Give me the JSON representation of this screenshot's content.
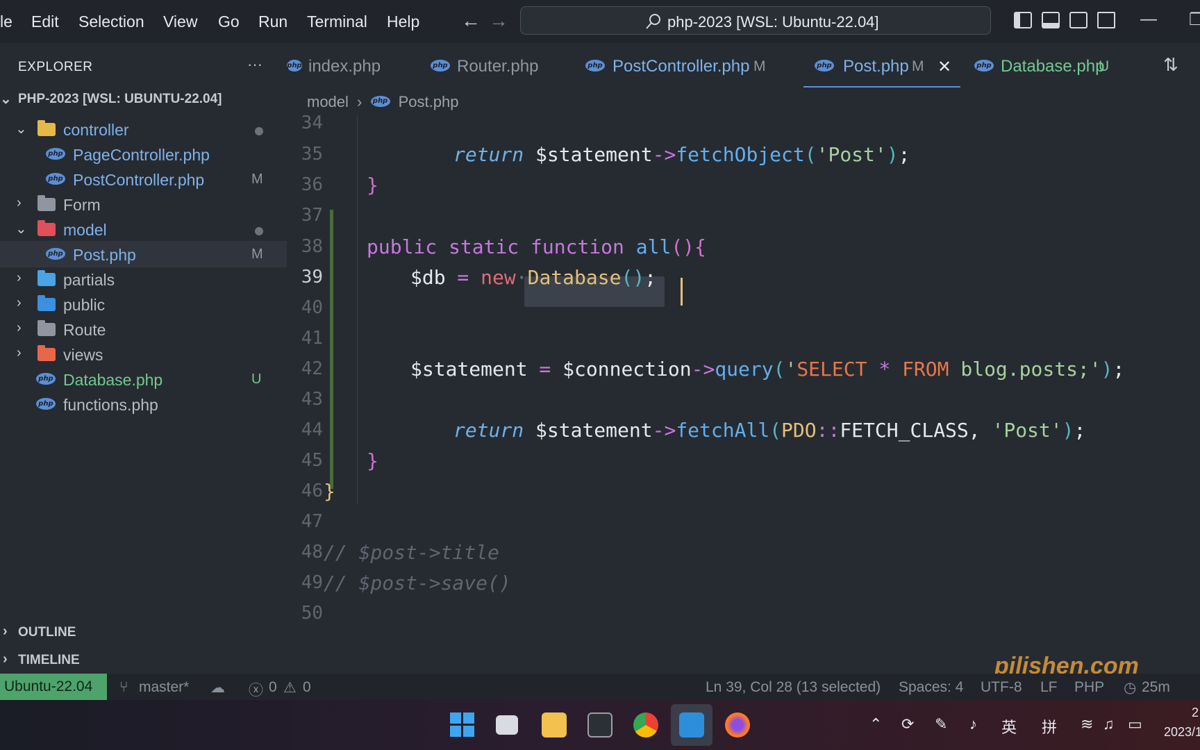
{
  "menu": [
    "le",
    "Edit",
    "Selection",
    "View",
    "Go",
    "Run",
    "Terminal",
    "Help"
  ],
  "command_center": "php-2023 [WSL: Ubuntu-22.04]",
  "explorer": {
    "title": "EXPLORER",
    "more": "···",
    "root": "PHP-2023 [WSL: UBUNTU-22.04]",
    "items": [
      {
        "label": "controller",
        "badge": ""
      },
      {
        "label": "PageController.php",
        "badge": ""
      },
      {
        "label": "PostController.php",
        "badge": "M"
      },
      {
        "label": "Form",
        "badge": ""
      },
      {
        "label": "model",
        "badge": ""
      },
      {
        "label": "Post.php",
        "badge": "M"
      },
      {
        "label": "partials",
        "badge": ""
      },
      {
        "label": "public",
        "badge": ""
      },
      {
        "label": "Route",
        "badge": ""
      },
      {
        "label": "views",
        "badge": ""
      },
      {
        "label": "Database.php",
        "badge": "U"
      },
      {
        "label": "functions.php",
        "badge": ""
      }
    ],
    "outline": "OUTLINE",
    "timeline": "TIMELINE"
  },
  "tabs": [
    {
      "label": "index.php",
      "badge": ""
    },
    {
      "label": "Router.php",
      "badge": ""
    },
    {
      "label": "PostController.php",
      "badge": "M"
    },
    {
      "label": "Post.php",
      "badge": "M",
      "close": "✕"
    },
    {
      "label": "Database.php",
      "badge": "U"
    }
  ],
  "breadcrumb": {
    "folder": "model",
    "sep": "›",
    "file": "Post.php"
  },
  "php_icon_text": "php",
  "line_numbers": [
    "34",
    "35",
    "36",
    "37",
    "38",
    "39",
    "40",
    "41",
    "42",
    "43",
    "44",
    "45",
    "46",
    "47",
    "48",
    "49",
    "50"
  ],
  "code": {
    "l35": {
      "kw": "return",
      "var": " $statement",
      "arrow": "->",
      "fn": "fetchObject",
      "p1": "(",
      "str": "'Post'",
      "p2": ")",
      "semi": ";"
    },
    "l36": "}",
    "l38": {
      "a": "public",
      "b": "static",
      "c": "function",
      "fn": "all",
      "p": "()",
      "brace": "{"
    },
    "l39": {
      "var": "$db",
      "eq": " = ",
      "new": "new",
      "dot": "·",
      "cls": "Database",
      "p1": "(",
      "p2": ")",
      "semi": ";"
    },
    "l42": {
      "var": "$statement",
      "eq": " = ",
      "var2": "$connection",
      "arrow": "->",
      "fn": "query",
      "p1": "(",
      "s1": "'",
      "k1": "SELECT",
      "star": " * ",
      "k2": "FROM",
      "s2": " blog.posts;'",
      "p2": ")",
      "semi": ";"
    },
    "l44": {
      "kw": "return",
      "var": " $statement",
      "arrow": "->",
      "fn": "fetchAll",
      "p1": "(",
      "cls": "PDO",
      "dc": "::",
      "const": "FETCH_CLASS",
      "comma": ", ",
      "str": "'Post'",
      "p2": ")",
      "semi": ";"
    },
    "l45": "}",
    "l46": "}",
    "l48": "// $post->title",
    "l49": "// $post->save()"
  },
  "status": {
    "remote": "Ubuntu-22.04",
    "branch": "master*",
    "errors": "0",
    "warnings": "0",
    "position": "Ln 39, Col 28 (13 selected)",
    "spaces": "Spaces: 4",
    "encoding": "UTF-8",
    "eol": "LF",
    "language": "PHP",
    "time": "25m"
  },
  "tray": {
    "ime1": "英",
    "ime2": "拼",
    "date": "2023/1",
    "hour": "2"
  },
  "watermark": "pilishen.com",
  "colors": {
    "accent": "#5c8fd6",
    "remote": "#4ea36b",
    "modified": "#d7ba7d",
    "untracked": "#73c991"
  }
}
